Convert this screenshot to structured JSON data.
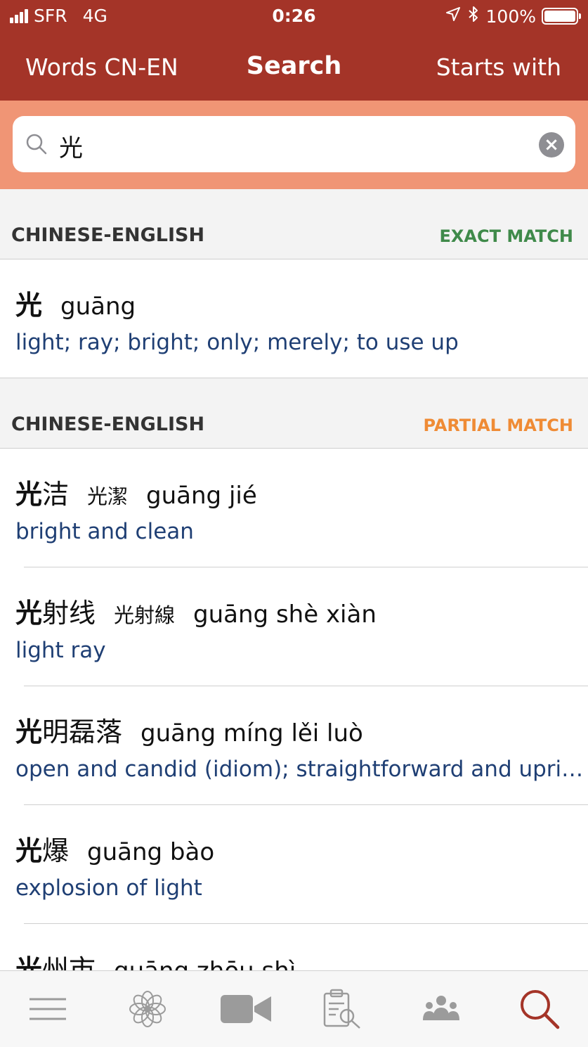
{
  "status_bar": {
    "carrier": "SFR",
    "network": "4G",
    "time": "0:26",
    "location_icon": "location-arrow-icon",
    "bluetooth_icon": "bluetooth-icon",
    "battery": "100%"
  },
  "nav": {
    "left_label": "Words CN-EN",
    "title": "Search",
    "right_label": "Starts with"
  },
  "search": {
    "value": "光",
    "icon": "search-icon",
    "clear_icon": "clear-icon"
  },
  "sections": [
    {
      "name": "CHINESE-ENGLISH",
      "match_label": "EXACT MATCH",
      "match_color": "#3f8a4a",
      "entries": [
        {
          "hanzi_first": "光",
          "hanzi_rest": "",
          "traditional": "",
          "pinyin": "guāng",
          "definition": "light; ray; bright; only; merely; to use up"
        }
      ]
    },
    {
      "name": "CHINESE-ENGLISH",
      "match_label": "PARTIAL MATCH",
      "match_color": "#ef8b35",
      "entries": [
        {
          "hanzi_first": "光",
          "hanzi_rest": "洁",
          "traditional": "光潔",
          "pinyin": "guāng jié",
          "definition": "bright and clean"
        },
        {
          "hanzi_first": "光",
          "hanzi_rest": "射线",
          "traditional": "光射線",
          "pinyin": "guāng shè xiàn",
          "definition": "light ray"
        },
        {
          "hanzi_first": "光",
          "hanzi_rest": "明磊落",
          "traditional": "",
          "pinyin": "guāng míng lěi luò",
          "definition": "open and candid (idiom); straightforward and upright"
        },
        {
          "hanzi_first": "光",
          "hanzi_rest": "爆",
          "traditional": "",
          "pinyin": "guāng bào",
          "definition": "explosion of light"
        },
        {
          "hanzi_first": "光",
          "hanzi_rest": "州市",
          "traditional": "",
          "pinyin": "guāng zhōu shì",
          "definition": ""
        }
      ]
    }
  ],
  "tabs": [
    {
      "icon": "menu-icon",
      "active": false
    },
    {
      "icon": "flower-icon",
      "active": false
    },
    {
      "icon": "video-camera-icon",
      "active": false
    },
    {
      "icon": "clipboard-search-icon",
      "active": false
    },
    {
      "icon": "community-icon",
      "active": false
    },
    {
      "icon": "search-icon",
      "active": true
    }
  ],
  "colors": {
    "header": "#a43428",
    "search_bar_bg": "#f09575",
    "definition": "#1f3f74",
    "tab_inactive": "#9b9b9b",
    "tab_active": "#a43428"
  }
}
